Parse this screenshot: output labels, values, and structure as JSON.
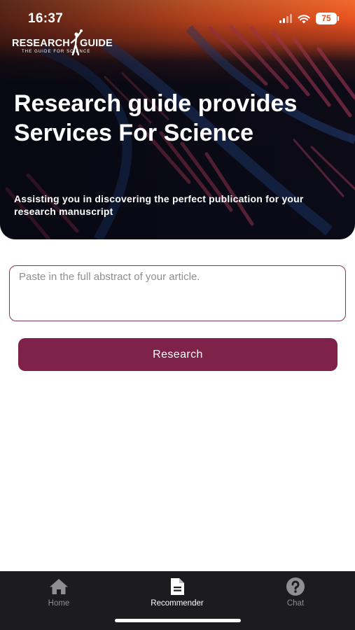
{
  "status_bar": {
    "time": "16:37",
    "battery_level": "75"
  },
  "logo": {
    "word1": "RESEARCH",
    "word2": "GUIDE",
    "tagline": "THE GUIDE FOR SCIENCE"
  },
  "hero": {
    "title": "Research guide provides Services For Science",
    "subtitle": "Assisting you in discovering the perfect publication for your research manuscript"
  },
  "abstract_input": {
    "placeholder": "Paste in the full abstract of your article.",
    "value": ""
  },
  "research_button": {
    "label": "Research"
  },
  "tab_bar": {
    "tabs": [
      {
        "label": "Home",
        "icon": "home-icon",
        "active": false
      },
      {
        "label": "Recommender",
        "icon": "document-icon",
        "active": true
      },
      {
        "label": "Chat",
        "icon": "question-circle-icon",
        "active": false
      }
    ]
  },
  "colors": {
    "accent": "#7f2249",
    "hero_top": "#e8521f",
    "hero_bottom": "#0b0b18",
    "tab_bar_bg": "#1c1c1e",
    "tab_inactive": "#8e8e93",
    "tab_active": "#ffffff"
  }
}
